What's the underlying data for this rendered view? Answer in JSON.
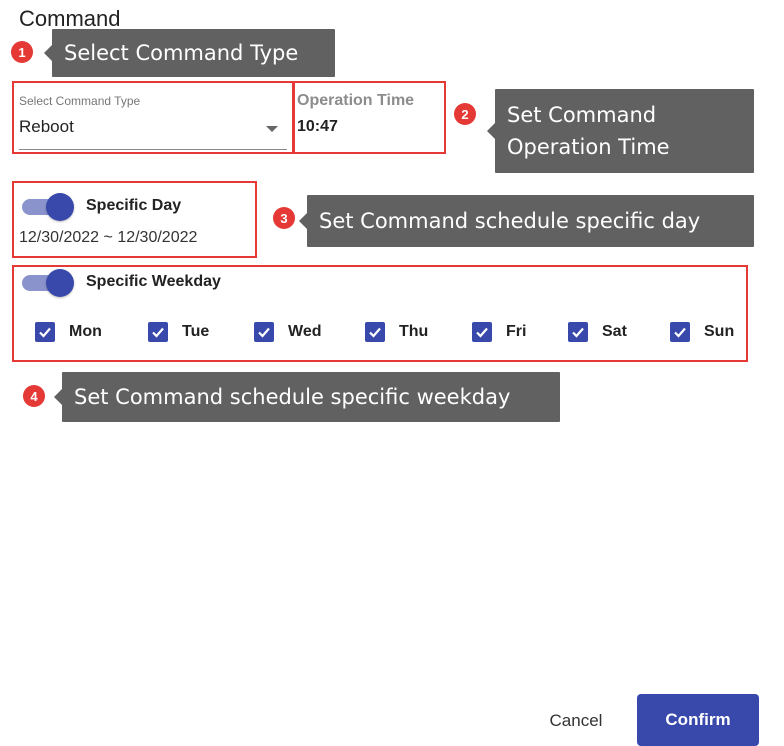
{
  "dialog": {
    "title": "Command"
  },
  "command_type": {
    "label": "Select Command Type",
    "value": "Reboot"
  },
  "operation_time": {
    "label": "Operation Time",
    "value": "10:47"
  },
  "specific_day": {
    "label": "Specific Day",
    "enabled": true,
    "range": "12/30/2022 ~ 12/30/2022"
  },
  "specific_weekday": {
    "label": "Specific Weekday",
    "enabled": true,
    "days": [
      {
        "label": "Mon",
        "checked": true
      },
      {
        "label": "Tue",
        "checked": true
      },
      {
        "label": "Wed",
        "checked": true
      },
      {
        "label": "Thu",
        "checked": true
      },
      {
        "label": "Fri",
        "checked": true
      },
      {
        "label": "Sat",
        "checked": true
      },
      {
        "label": "Sun",
        "checked": true
      }
    ]
  },
  "annotations": [
    {
      "number": "1",
      "text": "Select Command Type"
    },
    {
      "number": "2",
      "text": "Set Command Operation Time"
    },
    {
      "number": "3",
      "text": "Set Command schedule specific day"
    },
    {
      "number": "4",
      "text": "Set Command schedule specific weekday"
    }
  ],
  "actions": {
    "cancel": "Cancel",
    "confirm": "Confirm"
  },
  "colors": {
    "primary": "#3949ab",
    "highlight": "#e53935",
    "callout_bg": "#616161",
    "toggle_track": "#8a93cc"
  },
  "icons": {
    "dropdown": "caret-down-icon",
    "checkbox": "check-icon"
  }
}
